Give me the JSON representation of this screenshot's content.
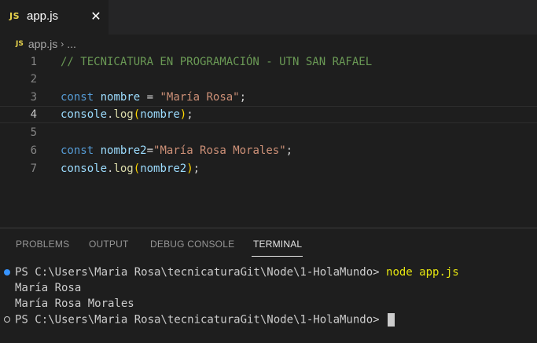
{
  "tab": {
    "badge": "JS",
    "label": "app.js",
    "close": "✕"
  },
  "breadcrumb": {
    "badge": "JS",
    "file": "app.js",
    "separator": "›",
    "more": "..."
  },
  "editor": {
    "lines": [
      {
        "number": "1",
        "comment": "// TECNICATURA EN PROGRAMACIÓN - UTN SAN RAFAEL"
      },
      {
        "number": "2"
      },
      {
        "number": "3",
        "keyword": "const",
        "name": "nombre",
        "op": " = ",
        "string": "\"María Rosa\"",
        "end": ";"
      },
      {
        "number": "4",
        "obj": "console",
        "dot": ".",
        "func": "log",
        "open": "(",
        "arg": "nombre",
        "close": ")",
        "end": ";"
      },
      {
        "number": "5"
      },
      {
        "number": "6",
        "keyword": "const",
        "name": "nombre2",
        "op": "=",
        "string": "\"María Rosa Morales\"",
        "end": ";"
      },
      {
        "number": "7",
        "obj": "console",
        "dot": ".",
        "func": "log",
        "open": "(",
        "arg": "nombre2",
        "close": ")",
        "end": ";"
      }
    ]
  },
  "panel": {
    "tabs": [
      "PROBLEMS",
      "OUTPUT",
      "DEBUG CONSOLE",
      "TERMINAL"
    ],
    "active_tab": "TERMINAL"
  },
  "terminal": {
    "prompt1": "PS C:\\Users\\Maria Rosa\\tecnicaturaGit\\Node\\1-HolaMundo> ",
    "command1": "node app.js",
    "output1": "María Rosa",
    "output2": "María Rosa Morales",
    "prompt2": "PS C:\\Users\\Maria Rosa\\tecnicaturaGit\\Node\\1-HolaMundo> "
  },
  "colors": {
    "background": "#1e1e1e",
    "tab_bar": "#252526",
    "js_badge": "#e8d44d",
    "comment": "#6a9955",
    "keyword": "#569cd6",
    "variable": "#9cdcfe",
    "string": "#ce9178",
    "function": "#dcdcaa",
    "bracket": "#ffd700",
    "terminal_command": "#e5e510",
    "terminal_dot": "#3794ff"
  }
}
